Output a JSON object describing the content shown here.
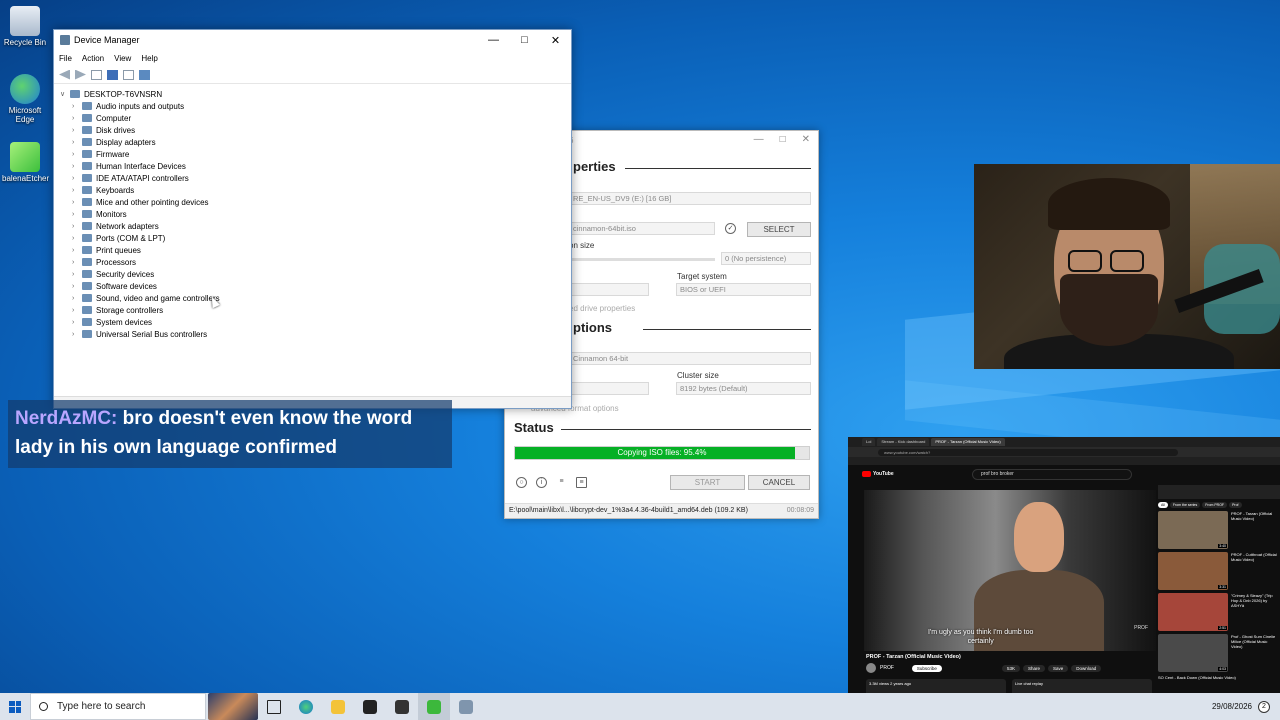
{
  "desktop": {
    "icons": [
      {
        "label": "Recycle Bin"
      },
      {
        "label": "Microsoft Edge"
      },
      {
        "label": "balenaEtcher"
      }
    ]
  },
  "device_manager": {
    "title": "Device Manager",
    "menu": [
      "File",
      "Action",
      "View",
      "Help"
    ],
    "root": "DESKTOP-T6VNSRN",
    "categories": [
      "Audio inputs and outputs",
      "Computer",
      "Disk drives",
      "Display adapters",
      "Firmware",
      "Human Interface Devices",
      "IDE ATA/ATAPI controllers",
      "Keyboards",
      "Mice and other pointing devices",
      "Monitors",
      "Network adapters",
      "Ports (COM & LPT)",
      "Print queues",
      "Processors",
      "Security devices",
      "Software devices",
      "Sound, video and game controllers",
      "Storage controllers",
      "System devices",
      "Universal Serial Bus controllers"
    ]
  },
  "rufus": {
    "title_fragment": "6",
    "sections": {
      "properties": "perties",
      "options": "ptions",
      "status": "Status"
    },
    "device_value": "RE_EN-US_DV9 (E:) [16 GB]",
    "boot_value": "cinnamon-64bit.iso",
    "select_label": "SELECT",
    "persistence_label": "on size",
    "persistence_value": "0 (No persistence)",
    "target_system_label": "Target system",
    "target_system_value": "BIOS or UEFI",
    "drive_props_fragment": "ed drive properties",
    "volume_label_value": "Cinnamon 64-bit",
    "cluster_size_label": "Cluster size",
    "cluster_size_value": "8192 bytes (Default)",
    "format_options_fragment": "advanced format options",
    "progress_text": "Copying ISO files: 95.4%",
    "progress_percent": 95.4,
    "start_label": "START",
    "cancel_label": "CANCEL",
    "status_text": "E:\\pool\\main\\libx\\l...\\libcrypt-dev_1%3a4.4.36-4build1_amd64.deb (109.2 KB)",
    "elapsed": "00:08:09"
  },
  "chat": {
    "username": "NerdAzMC:",
    "message": "bro doesn't even know the word lady in his own language confirmed"
  },
  "youtube": {
    "tabs": [
      "Lol",
      "Stream - Kick dashboard",
      "PROF - Tarzan (Official Music Video)"
    ],
    "url": "www.youtube.com/watch?",
    "search_query": "prof bro broker",
    "subtitle_line1": "I'm ugly as you think I'm dumb too",
    "subtitle_line2": "certainly",
    "watermark": "PROF",
    "video_title": "PROF - Tarzan (Official Music Video)",
    "channel": "PROF",
    "subscribe_label": "Subscribe",
    "actions": [
      "53K",
      "Share",
      "Save",
      "Download"
    ],
    "views": "3.3M views  2 years ago",
    "live_chat_label": "Live chat replay",
    "chips": [
      "All",
      "From the series",
      "From PROF",
      "Prof"
    ],
    "side_items": [
      {
        "title": "PROF - Tarzan (Official Music Video)",
        "duration": "3:40"
      },
      {
        "title": "PROF - Cutthroat (Official Music Video)",
        "duration": "3:31"
      },
      {
        "title": "\"Crimey & Sleazy\" (Trip Hop & Dnb 2026) by ASHYä",
        "duration": "2:51"
      },
      {
        "title": "Prof - Ghost Sum Cinelie Milice (Official Music Video)",
        "duration": "4:03"
      }
    ],
    "side_last": "SO Cent - Back Down (Official Music Video)"
  },
  "taskbar": {
    "search_placeholder": "Type here to search",
    "date": "29/08/2026",
    "notification_count": "2"
  }
}
